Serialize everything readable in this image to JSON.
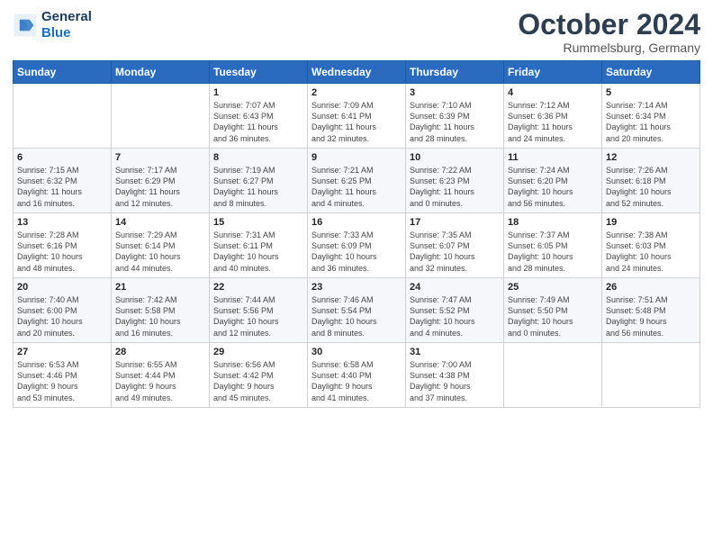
{
  "logo": {
    "line1": "General",
    "line2": "Blue"
  },
  "title": "October 2024",
  "subtitle": "Rummelsburg, Germany",
  "days_header": [
    "Sunday",
    "Monday",
    "Tuesday",
    "Wednesday",
    "Thursday",
    "Friday",
    "Saturday"
  ],
  "weeks": [
    [
      {
        "day": "",
        "content": ""
      },
      {
        "day": "",
        "content": ""
      },
      {
        "day": "1",
        "content": "Sunrise: 7:07 AM\nSunset: 6:43 PM\nDaylight: 11 hours\nand 36 minutes."
      },
      {
        "day": "2",
        "content": "Sunrise: 7:09 AM\nSunset: 6:41 PM\nDaylight: 11 hours\nand 32 minutes."
      },
      {
        "day": "3",
        "content": "Sunrise: 7:10 AM\nSunset: 6:39 PM\nDaylight: 11 hours\nand 28 minutes."
      },
      {
        "day": "4",
        "content": "Sunrise: 7:12 AM\nSunset: 6:36 PM\nDaylight: 11 hours\nand 24 minutes."
      },
      {
        "day": "5",
        "content": "Sunrise: 7:14 AM\nSunset: 6:34 PM\nDaylight: 11 hours\nand 20 minutes."
      }
    ],
    [
      {
        "day": "6",
        "content": "Sunrise: 7:15 AM\nSunset: 6:32 PM\nDaylight: 11 hours\nand 16 minutes."
      },
      {
        "day": "7",
        "content": "Sunrise: 7:17 AM\nSunset: 6:29 PM\nDaylight: 11 hours\nand 12 minutes."
      },
      {
        "day": "8",
        "content": "Sunrise: 7:19 AM\nSunset: 6:27 PM\nDaylight: 11 hours\nand 8 minutes."
      },
      {
        "day": "9",
        "content": "Sunrise: 7:21 AM\nSunset: 6:25 PM\nDaylight: 11 hours\nand 4 minutes."
      },
      {
        "day": "10",
        "content": "Sunrise: 7:22 AM\nSunset: 6:23 PM\nDaylight: 11 hours\nand 0 minutes."
      },
      {
        "day": "11",
        "content": "Sunrise: 7:24 AM\nSunset: 6:20 PM\nDaylight: 10 hours\nand 56 minutes."
      },
      {
        "day": "12",
        "content": "Sunrise: 7:26 AM\nSunset: 6:18 PM\nDaylight: 10 hours\nand 52 minutes."
      }
    ],
    [
      {
        "day": "13",
        "content": "Sunrise: 7:28 AM\nSunset: 6:16 PM\nDaylight: 10 hours\nand 48 minutes."
      },
      {
        "day": "14",
        "content": "Sunrise: 7:29 AM\nSunset: 6:14 PM\nDaylight: 10 hours\nand 44 minutes."
      },
      {
        "day": "15",
        "content": "Sunrise: 7:31 AM\nSunset: 6:11 PM\nDaylight: 10 hours\nand 40 minutes."
      },
      {
        "day": "16",
        "content": "Sunrise: 7:33 AM\nSunset: 6:09 PM\nDaylight: 10 hours\nand 36 minutes."
      },
      {
        "day": "17",
        "content": "Sunrise: 7:35 AM\nSunset: 6:07 PM\nDaylight: 10 hours\nand 32 minutes."
      },
      {
        "day": "18",
        "content": "Sunrise: 7:37 AM\nSunset: 6:05 PM\nDaylight: 10 hours\nand 28 minutes."
      },
      {
        "day": "19",
        "content": "Sunrise: 7:38 AM\nSunset: 6:03 PM\nDaylight: 10 hours\nand 24 minutes."
      }
    ],
    [
      {
        "day": "20",
        "content": "Sunrise: 7:40 AM\nSunset: 6:00 PM\nDaylight: 10 hours\nand 20 minutes."
      },
      {
        "day": "21",
        "content": "Sunrise: 7:42 AM\nSunset: 5:58 PM\nDaylight: 10 hours\nand 16 minutes."
      },
      {
        "day": "22",
        "content": "Sunrise: 7:44 AM\nSunset: 5:56 PM\nDaylight: 10 hours\nand 12 minutes."
      },
      {
        "day": "23",
        "content": "Sunrise: 7:46 AM\nSunset: 5:54 PM\nDaylight: 10 hours\nand 8 minutes."
      },
      {
        "day": "24",
        "content": "Sunrise: 7:47 AM\nSunset: 5:52 PM\nDaylight: 10 hours\nand 4 minutes."
      },
      {
        "day": "25",
        "content": "Sunrise: 7:49 AM\nSunset: 5:50 PM\nDaylight: 10 hours\nand 0 minutes."
      },
      {
        "day": "26",
        "content": "Sunrise: 7:51 AM\nSunset: 5:48 PM\nDaylight: 9 hours\nand 56 minutes."
      }
    ],
    [
      {
        "day": "27",
        "content": "Sunrise: 6:53 AM\nSunset: 4:46 PM\nDaylight: 9 hours\nand 53 minutes."
      },
      {
        "day": "28",
        "content": "Sunrise: 6:55 AM\nSunset: 4:44 PM\nDaylight: 9 hours\nand 49 minutes."
      },
      {
        "day": "29",
        "content": "Sunrise: 6:56 AM\nSunset: 4:42 PM\nDaylight: 9 hours\nand 45 minutes."
      },
      {
        "day": "30",
        "content": "Sunrise: 6:58 AM\nSunset: 4:40 PM\nDaylight: 9 hours\nand 41 minutes."
      },
      {
        "day": "31",
        "content": "Sunrise: 7:00 AM\nSunset: 4:38 PM\nDaylight: 9 hours\nand 37 minutes."
      },
      {
        "day": "",
        "content": ""
      },
      {
        "day": "",
        "content": ""
      }
    ]
  ]
}
